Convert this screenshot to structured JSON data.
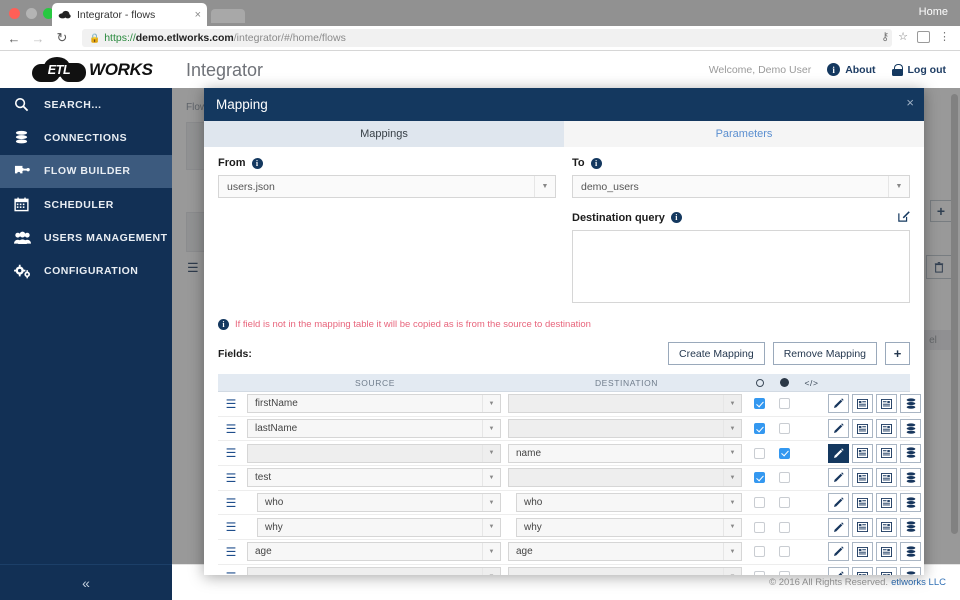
{
  "browser": {
    "tab_title": "Integrator - flows",
    "tab_close": "×",
    "home_label": "Home",
    "back_icon": "←",
    "forward_icon": "→",
    "reload_icon": "↻",
    "home_icon": "⌂",
    "lock_icon": "🔒",
    "url_scheme": "https://",
    "url_host": "demo.etlworks.com",
    "url_path": "/integrator/#/home/flows",
    "key_icon": "⚷",
    "star_icon": "☆",
    "menu_icon": "⋮"
  },
  "app_header": {
    "logo_text": "ETL",
    "logo_suffix": "WORKS",
    "title": "Integrator",
    "welcome": "Welcome, Demo User",
    "about_label": "About",
    "about_icon_char": "i",
    "logout_label": "Log out"
  },
  "sidebar": {
    "items": [
      {
        "label": "SEARCH...",
        "icon": "search-icon",
        "active": false
      },
      {
        "label": "CONNECTIONS",
        "icon": "database-icon",
        "active": false
      },
      {
        "label": "FLOW BUILDER",
        "icon": "puzzle-icon",
        "active": true
      },
      {
        "label": "SCHEDULER",
        "icon": "calendar-icon",
        "active": false
      },
      {
        "label": "USERS MANAGEMENT",
        "icon": "users-icon",
        "active": false
      },
      {
        "label": "CONFIGURATION",
        "icon": "gears-icon",
        "active": false
      }
    ],
    "collapse_icon": "«"
  },
  "background": {
    "breadcrumb": "Flow",
    "plus_label": "+",
    "cancel_label": "el",
    "trash_icon": "trash-icon"
  },
  "footer": {
    "copyright": "© 2016 All Rights Reserved.",
    "link": "etlworks LLC"
  },
  "modal": {
    "title": "Mapping",
    "close_icon": "×",
    "tabs": [
      {
        "label": "Mappings",
        "active": true
      },
      {
        "label": "Parameters",
        "active": false
      }
    ],
    "from": {
      "label": "From",
      "value": "users.json",
      "info_char": "i"
    },
    "to": {
      "label": "To",
      "value": "demo_users",
      "info_char": "i"
    },
    "destination_query": {
      "label": "Destination query",
      "info_char": "i",
      "value": "",
      "edit_icon": "edit-icon"
    },
    "note": {
      "info_char": "i",
      "text": "If field is not in the mapping table it will be copied as is from the source to destination"
    },
    "fields_label": "Fields:",
    "buttons": {
      "create_mapping": "Create Mapping",
      "remove_mapping": "Remove Mapping",
      "add": "+"
    },
    "table": {
      "headers": {
        "handle": "",
        "source": "SOURCE",
        "destination": "DESTINATION",
        "ring": "○",
        "filled": "●",
        "code": "</>"
      },
      "rows": [
        {
          "source": "firstName",
          "destination": "",
          "ring_checked": true,
          "filled_checked": false,
          "indent": false,
          "edit_active": false
        },
        {
          "source": "lastName",
          "destination": "",
          "ring_checked": true,
          "filled_checked": false,
          "indent": false,
          "edit_active": false
        },
        {
          "source": "",
          "destination": "name",
          "ring_checked": false,
          "filled_checked": true,
          "indent": false,
          "edit_active": true
        },
        {
          "source": "test",
          "destination": "",
          "ring_checked": true,
          "filled_checked": false,
          "indent": false,
          "edit_active": false
        },
        {
          "source": "who",
          "destination": "who",
          "ring_checked": false,
          "filled_checked": false,
          "indent": true,
          "edit_active": false
        },
        {
          "source": "why",
          "destination": "why",
          "ring_checked": false,
          "filled_checked": false,
          "indent": true,
          "edit_active": false
        },
        {
          "source": "age",
          "destination": "age",
          "ring_checked": false,
          "filled_checked": false,
          "indent": false,
          "edit_active": false
        },
        {
          "source": "",
          "destination": "",
          "ring_checked": false,
          "filled_checked": false,
          "indent": false,
          "edit_active": false
        }
      ],
      "action_icons": [
        "pencil-icon",
        "indent-left-icon",
        "indent-right-icon",
        "database-icon",
        "trash-icon"
      ]
    }
  },
  "colors": {
    "brand_navy": "#14385f",
    "sidebar_navy": "#123055",
    "sidebar_active": "#3c5a7e",
    "tab_active_bg": "#dfe6ee",
    "link_blue": "#5b8fd0",
    "note_red": "#e8657c",
    "checkbox_blue": "#3498f0"
  }
}
